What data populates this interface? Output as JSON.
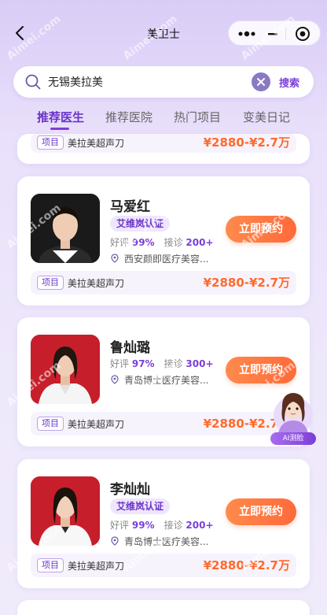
{
  "nav": {
    "title": "美卫士"
  },
  "search": {
    "value": "无锡美拉美",
    "button": "搜索"
  },
  "tabs": [
    "推荐医生",
    "推荐医院",
    "热门项目",
    "变美日记"
  ],
  "partial_card": {
    "tag": "项目",
    "project": "美拉美超声刀",
    "price": "¥2880-¥2.7万"
  },
  "doctors": [
    {
      "name": "马爱红",
      "cert": "艾维岚认证",
      "rating_label": "好评",
      "rating": "99%",
      "consult_label": "接诊",
      "consult": "200+",
      "location": "西安颜即医疗美容...",
      "book": "立即预约",
      "tag": "项目",
      "project": "美拉美超声刀",
      "price": "¥2880-¥2.7万"
    },
    {
      "name": "鲁灿璐",
      "cert": "",
      "rating_label": "好评",
      "rating": "97%",
      "consult_label": "接诊",
      "consult": "300+",
      "location": "青岛博士医疗美容...",
      "book": "立即预约",
      "tag": "项目",
      "project": "美拉美超声刀",
      "price": "¥2880-¥2.7万"
    },
    {
      "name": "李灿灿",
      "cert": "艾维岚认证",
      "rating_label": "好评",
      "rating": "99%",
      "consult_label": "接诊",
      "consult": "200+",
      "location": "青岛博士医疗美容...",
      "book": "立即预约",
      "tag": "项目",
      "project": "美拉美超声刀",
      "price": "¥2880-¥2.7万"
    }
  ],
  "ai_float": {
    "label": "AI测脸"
  },
  "watermark": "Aimei.com",
  "colors": {
    "accent": "#7b3fd8",
    "price": "#ff6a2b",
    "book_button": "#ff7a40"
  },
  "icons": [
    "back-icon",
    "more-icon",
    "minus-icon",
    "target-icon",
    "search-icon",
    "clear-icon",
    "location-pin-icon"
  ]
}
